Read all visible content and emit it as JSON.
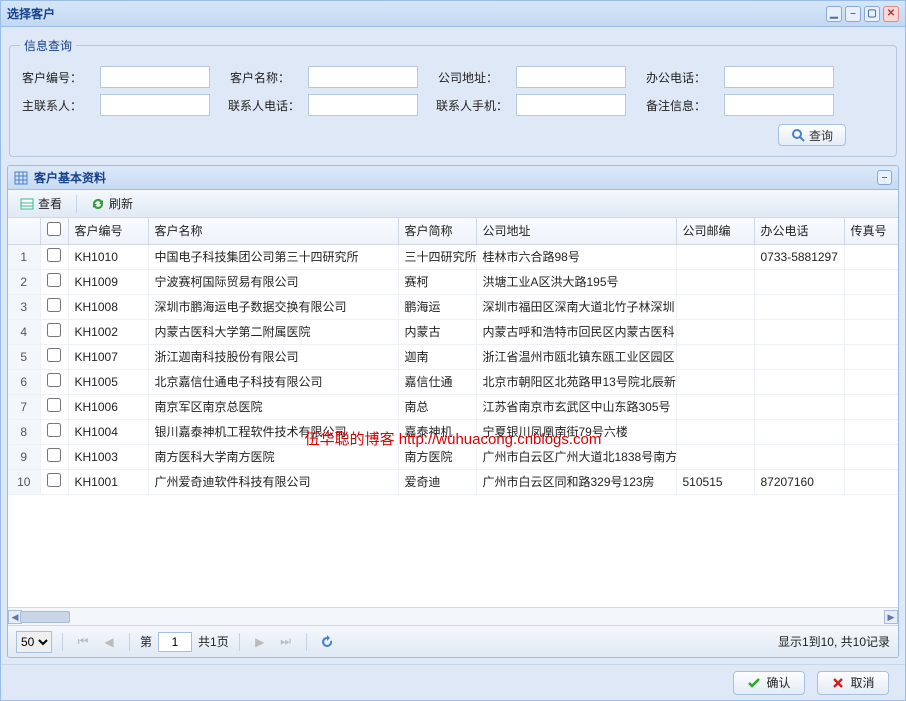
{
  "window": {
    "title": "选择客户"
  },
  "search": {
    "legend": "信息查询",
    "fields": {
      "customer_no": "客户编号：",
      "customer_name": "客户名称：",
      "company_addr": "公司地址：",
      "office_phone": "办公电话：",
      "main_contact": "主联系人：",
      "contact_phone": "联系人电话：",
      "contact_mobile": "联系人手机：",
      "remark": "备注信息："
    },
    "query_btn": "查询"
  },
  "panel": {
    "title": "客户基本资料"
  },
  "toolbar": {
    "view": "查看",
    "refresh": "刷新"
  },
  "columns": {
    "customer_no": "客户编号",
    "customer_name": "客户名称",
    "short_name": "客户简称",
    "company_addr": "公司地址",
    "company_zip": "公司邮编",
    "office_phone": "办公电话",
    "fax": "传真号"
  },
  "rows": [
    {
      "no": "KH1010",
      "name": "中国电子科技集团公司第三十四研究所",
      "short": "三十四研究所",
      "addr": "桂林市六合路98号",
      "zip": "",
      "phone": "0733-5881297"
    },
    {
      "no": "KH1009",
      "name": "宁波赛柯国际贸易有限公司",
      "short": "赛柯",
      "addr": "洪塘工业A区洪大路195号",
      "zip": "",
      "phone": ""
    },
    {
      "no": "KH1008",
      "name": "深圳市鹏海运电子数据交换有限公司",
      "short": "鹏海运",
      "addr": "深圳市福田区深南大道北竹子林深圳",
      "zip": "",
      "phone": ""
    },
    {
      "no": "KH1002",
      "name": "内蒙古医科大学第二附属医院",
      "short": "内蒙古",
      "addr": "内蒙古呼和浩特市回民区内蒙古医科",
      "zip": "",
      "phone": ""
    },
    {
      "no": "KH1007",
      "name": "浙江迦南科技股份有限公司",
      "short": "迦南",
      "addr": "浙江省温州市瓯北镇东瓯工业区园区",
      "zip": "",
      "phone": ""
    },
    {
      "no": "KH1005",
      "name": "北京嘉信仕通电子科技有限公司",
      "short": "嘉信仕通",
      "addr": "北京市朝阳区北苑路甲13号院北辰新",
      "zip": "",
      "phone": ""
    },
    {
      "no": "KH1006",
      "name": "南京军区南京总医院",
      "short": "南总",
      "addr": "江苏省南京市玄武区中山东路305号",
      "zip": "",
      "phone": ""
    },
    {
      "no": "KH1004",
      "name": "银川嘉泰神机工程软件技术有限公司",
      "short": "嘉泰神机",
      "addr": "宁夏银川凤凰南街79号六楼",
      "zip": "",
      "phone": ""
    },
    {
      "no": "KH1003",
      "name": "南方医科大学南方医院",
      "short": "南方医院",
      "addr": "广州市白云区广州大道北1838号南方",
      "zip": "",
      "phone": ""
    },
    {
      "no": "KH1001",
      "name": "广州爱奇迪软件科技有限公司",
      "short": "爱奇迪",
      "addr": "广州市白云区同和路329号123房",
      "zip": "510515",
      "phone": "87207160"
    }
  ],
  "watermark": "伍华聪的博客 http://wuhuacong.cnblogs.com",
  "pager": {
    "page_size": "50",
    "page_label_prefix": "第",
    "page_value": "1",
    "page_total": "共1页",
    "summary": "显示1到10, 共10记录"
  },
  "footer": {
    "ok": "确认",
    "cancel": "取消"
  }
}
